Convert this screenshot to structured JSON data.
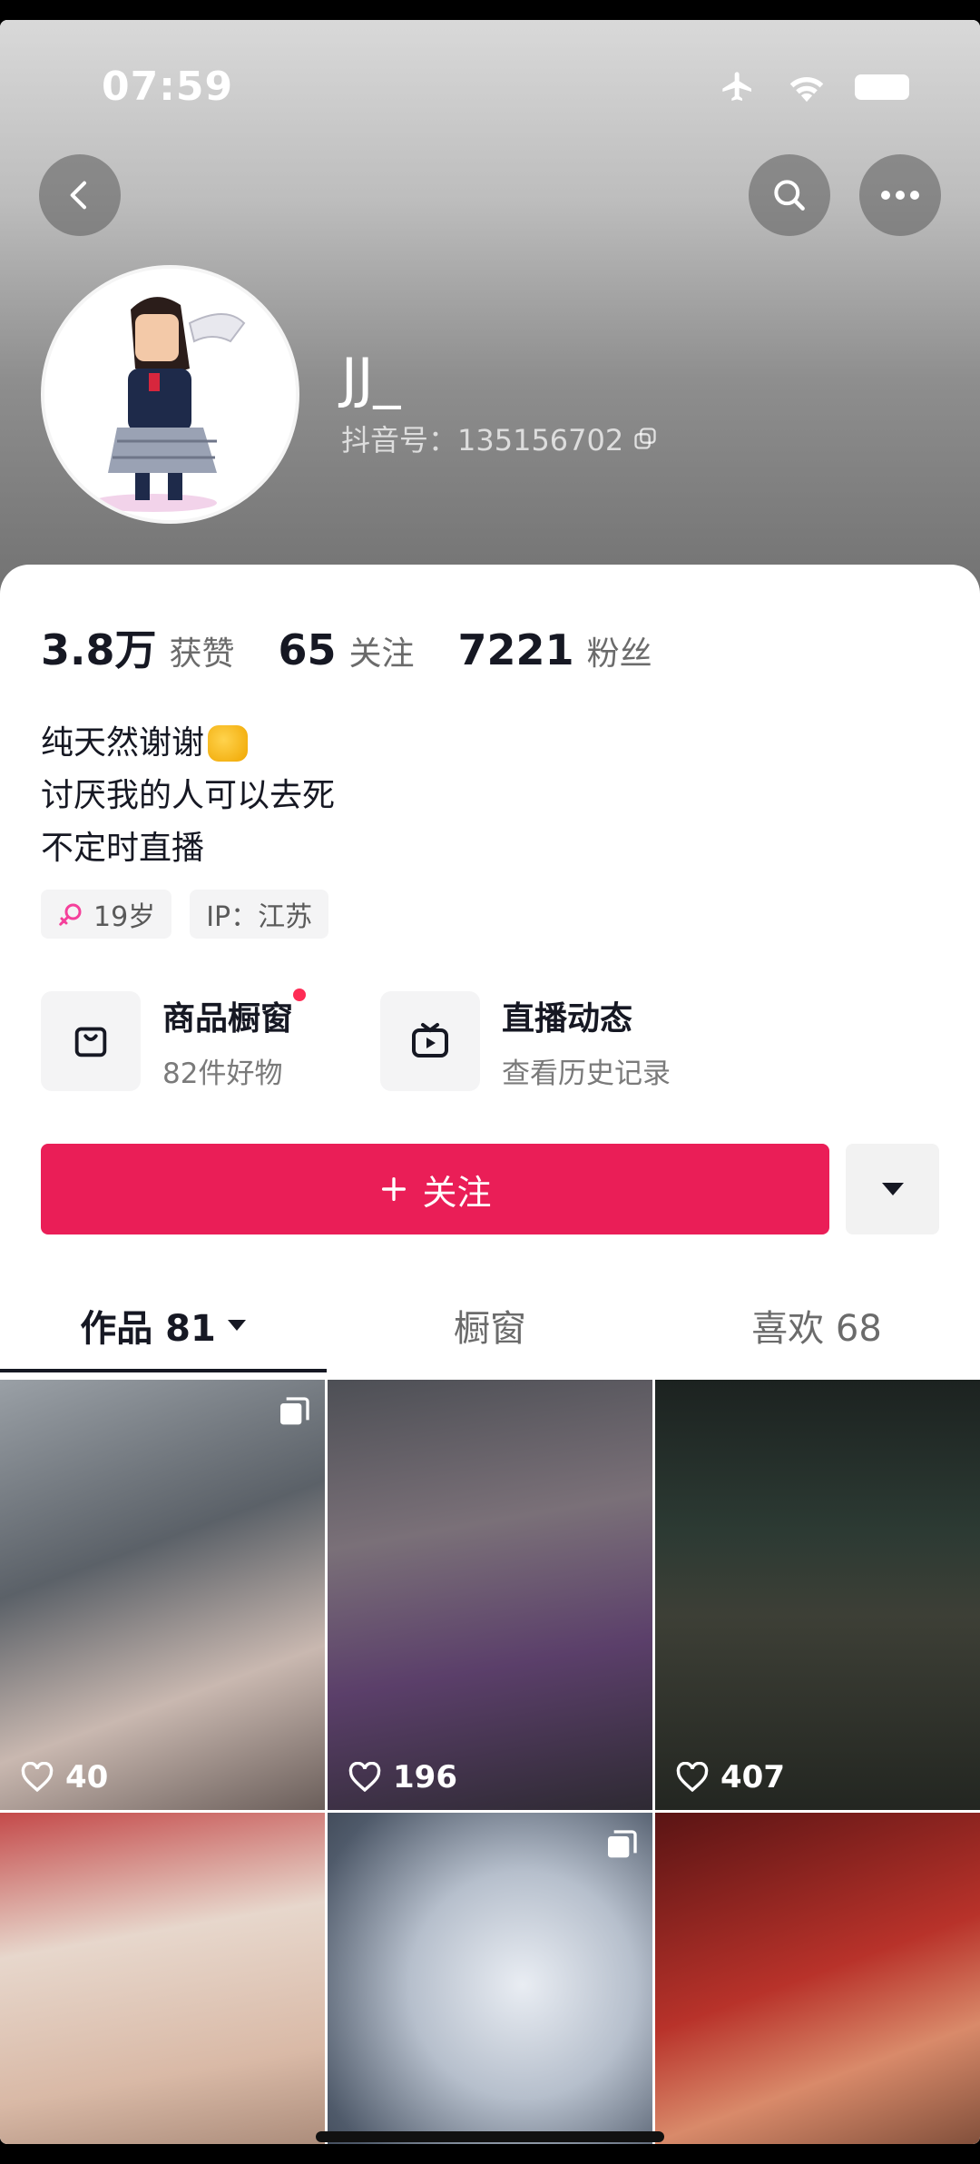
{
  "status": {
    "time": "07:59"
  },
  "profile": {
    "username": "JJ_",
    "douyin_id": "抖音号：135156702"
  },
  "stats": [
    {
      "num": "3.8万",
      "label": "获赞"
    },
    {
      "num": "65",
      "label": "关注"
    },
    {
      "num": "7221",
      "label": "粉丝"
    }
  ],
  "bio": {
    "line1": "纯天然谢谢",
    "line2": "讨厌我的人可以去死",
    "line3": "不定时直播"
  },
  "tags": {
    "age": "19岁",
    "ip": "IP：江苏"
  },
  "entries": {
    "shop_title": "商品橱窗",
    "shop_sub": "82件好物",
    "live_title": "直播动态",
    "live_sub": "查看历史记录"
  },
  "actions": {
    "follow_label": "关注"
  },
  "tabs": {
    "works": "作品 81",
    "showcase": "橱窗",
    "likes": "喜欢 68"
  },
  "videos": [
    {
      "likes": "40"
    },
    {
      "likes": "196"
    },
    {
      "likes": "407"
    },
    {
      "likes": ""
    },
    {
      "likes": ""
    },
    {
      "likes": ""
    }
  ],
  "colors": {
    "accent": "#ea1e57",
    "text": "#161823"
  }
}
